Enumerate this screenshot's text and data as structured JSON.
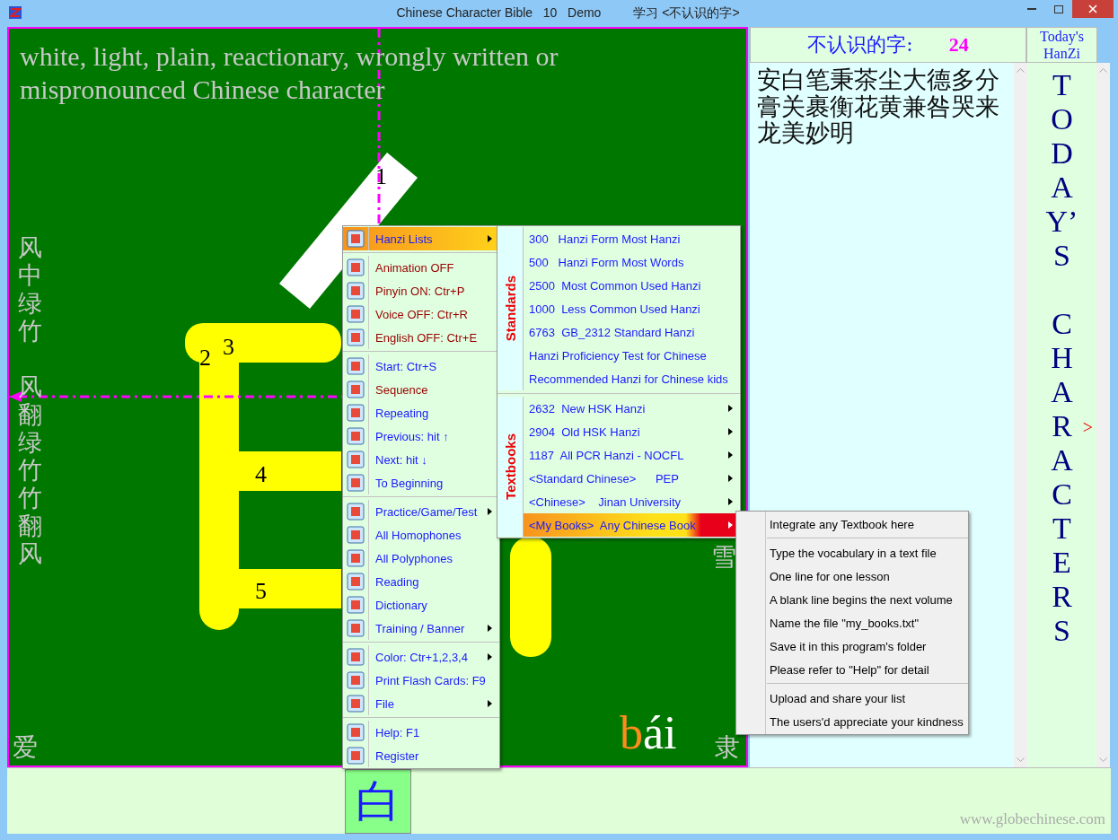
{
  "window": {
    "title": "Chinese Character Bible   10   Demo",
    "subtitle": "学习 <不认识的字>"
  },
  "canvas": {
    "meaning": "white, light, plain, reactionary, wrongly written or mispronounced Chinese character",
    "stroke_numbers": [
      "1",
      "2",
      "3",
      "4",
      "5"
    ],
    "side_words_top": "风中绿竹",
    "side_words_middle": "风翻绿竹竹翻风",
    "corner_left": "爱",
    "right_word": "雪",
    "corner_right": "隶",
    "pinyin_initial": "b",
    "pinyin_final": "ái"
  },
  "unknown_panel": {
    "label": "不认识的字:",
    "count": "24",
    "characters": "安白笔秉茶尘大德多分膏关裹衡花黄兼咎哭来龙美妙明"
  },
  "today_panel": {
    "heading": "Today's HanZi",
    "column_words": [
      "TODAY’S",
      "CHARACTERS"
    ],
    "next_marker": ">"
  },
  "menu": {
    "groups": [
      [
        {
          "label": "Hanzi Lists",
          "color": "#1a1aff",
          "has_submenu": true,
          "selected": true
        }
      ],
      [
        {
          "label": "Animation OFF",
          "color": "#990000",
          "has_submenu": false,
          "selected": false
        },
        {
          "label": "Pinyin ON: Ctr+P",
          "color": "#990000",
          "has_submenu": false,
          "selected": false
        },
        {
          "label": "Voice OFF: Ctr+R",
          "color": "#990000",
          "has_submenu": false,
          "selected": false
        },
        {
          "label": "English OFF: Ctr+E",
          "color": "#990000",
          "has_submenu": false,
          "selected": false
        }
      ],
      [
        {
          "label": "Start: Ctr+S",
          "color": "#1a1aff",
          "has_submenu": false,
          "selected": false
        },
        {
          "label": "Sequence",
          "color": "#990000",
          "has_submenu": false,
          "selected": false
        },
        {
          "label": "Repeating",
          "color": "#1a1aff",
          "has_submenu": false,
          "selected": false
        },
        {
          "label": "Previous: hit ↑",
          "color": "#1a1aff",
          "has_submenu": false,
          "selected": false
        },
        {
          "label": "Next: hit ↓",
          "color": "#1a1aff",
          "has_submenu": false,
          "selected": false
        },
        {
          "label": "To Beginning",
          "color": "#1a1aff",
          "has_submenu": false,
          "selected": false
        }
      ],
      [
        {
          "label": "Practice/Game/Test",
          "color": "#1a1aff",
          "has_submenu": true,
          "selected": false
        },
        {
          "label": "All Homophones",
          "color": "#1a1aff",
          "has_submenu": false,
          "selected": false
        },
        {
          "label": "All Polyphones",
          "color": "#1a1aff",
          "has_submenu": false,
          "selected": false
        },
        {
          "label": "Reading",
          "color": "#1a1aff",
          "has_submenu": false,
          "selected": false
        },
        {
          "label": "Dictionary",
          "color": "#1a1aff",
          "has_submenu": false,
          "selected": false
        },
        {
          "label": "Training / Banner",
          "color": "#1a1aff",
          "has_submenu": true,
          "selected": false
        }
      ],
      [
        {
          "label": "Color: Ctr+1,2,3,4",
          "color": "#1a1aff",
          "has_submenu": true,
          "selected": false
        },
        {
          "label": "Print Flash Cards: F9",
          "color": "#1a1aff",
          "has_submenu": false,
          "selected": false
        },
        {
          "label": "File",
          "color": "#1a1aff",
          "has_submenu": true,
          "selected": false
        }
      ],
      [
        {
          "label": "Help: F1",
          "color": "#1a1aff",
          "has_submenu": false,
          "selected": false
        },
        {
          "label": "Register",
          "color": "#1a1aff",
          "has_submenu": false,
          "selected": false
        }
      ]
    ]
  },
  "lists_menu": {
    "sections": [
      {
        "label": "Standards",
        "items": [
          {
            "label": "300   Hanzi Form Most Hanzi",
            "has_submenu": false,
            "selected": false
          },
          {
            "label": "500   Hanzi Form Most Words",
            "has_submenu": false,
            "selected": false
          },
          {
            "label": "2500  Most Common Used Hanzi",
            "has_submenu": false,
            "selected": false
          },
          {
            "label": "1000  Less Common Used Hanzi",
            "has_submenu": false,
            "selected": false
          },
          {
            "label": "6763  GB_2312 Standard Hanzi",
            "has_submenu": false,
            "selected": false
          },
          {
            "label": "Hanzi Proficiency Test for Chinese",
            "has_submenu": false,
            "selected": false
          },
          {
            "label": "Recommended Hanzi for Chinese kids",
            "has_submenu": false,
            "selected": false
          }
        ]
      },
      {
        "label": "Textbooks",
        "items": [
          {
            "label": "2632  New HSK Hanzi",
            "has_submenu": true,
            "selected": false
          },
          {
            "label": "2904  Old HSK Hanzi",
            "has_submenu": true,
            "selected": false
          },
          {
            "label": "1187  All PCR Hanzi - NOCFL",
            "has_submenu": true,
            "selected": false
          },
          {
            "label": "<Standard Chinese>      PEP",
            "has_submenu": true,
            "selected": false
          },
          {
            "label": "<Chinese>    Jinan University",
            "has_submenu": true,
            "selected": false
          },
          {
            "label": "<My Books>  Any Chinese Book",
            "has_submenu": true,
            "selected": true
          }
        ]
      }
    ]
  },
  "book_menu": {
    "groups": [
      [
        "Integrate any Textbook here"
      ],
      [
        "Type the vocabulary in a text file",
        "One line for one lesson",
        "A blank line begins the next volume",
        "Name the file \"my_books.txt\"",
        "Save it in this program's folder",
        "Please refer to \"Help\" for detail"
      ],
      [
        "Upload and share your list",
        "The users'd appreciate your kindness"
      ]
    ]
  },
  "bottom": {
    "current_character": "白",
    "website": "www.globechinese.com"
  }
}
